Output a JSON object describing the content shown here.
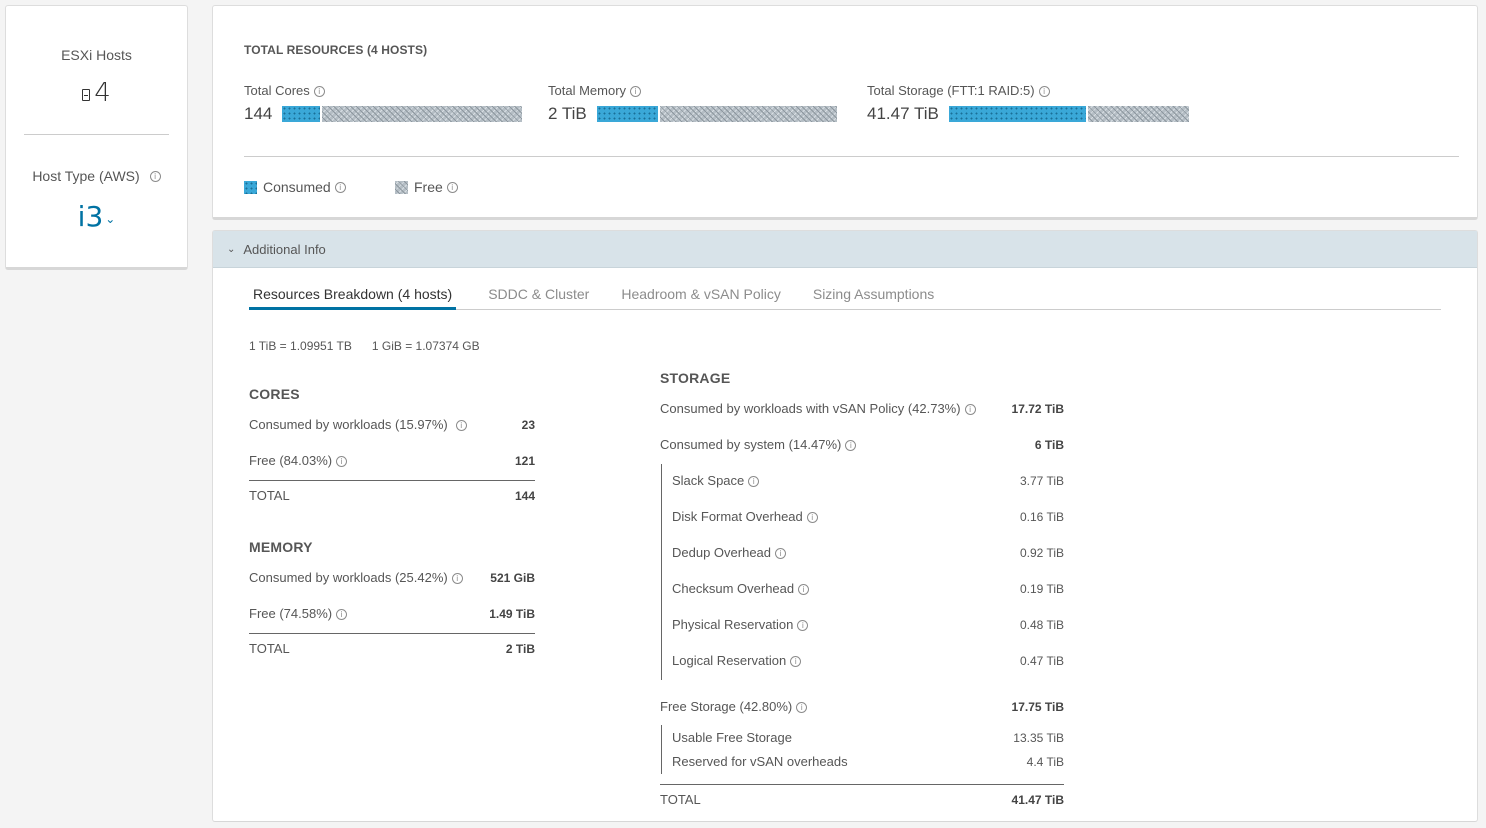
{
  "hosts": {
    "esxi_label": "ESXi Hosts",
    "esxi_count": "4",
    "host_type_label": "Host Type (AWS)",
    "host_type_value": "i3"
  },
  "resources": {
    "title": "TOTAL RESOURCES (4 HOSTS)",
    "metrics": [
      {
        "label": "Total Cores",
        "value": "144",
        "consumed_pct": 15.97
      },
      {
        "label": "Total Memory",
        "value": "2 TiB",
        "consumed_pct": 25.42
      },
      {
        "label": "Total Storage (FTT:1 RAID:5)",
        "value": "41.47 TiB",
        "consumed_pct": 57.2
      }
    ],
    "legend": {
      "consumed": "Consumed",
      "free": "Free"
    }
  },
  "colors": {
    "consumed": "#3aa8d8",
    "free": "#b5bec5",
    "accent": "#0072a3"
  },
  "info": {
    "header": "Additional Info",
    "tabs": [
      "Resources Breakdown (4 hosts)",
      "SDDC & Cluster",
      "Headroom & vSAN Policy",
      "Sizing Assumptions"
    ],
    "conversions": [
      "1 TiB = 1.09951 TB",
      "1 GiB = 1.07374 GB"
    ]
  },
  "cores": {
    "title": "CORES",
    "rows": [
      {
        "label": "Consumed by workloads (15.97%)",
        "value": "23"
      },
      {
        "label": "Free (84.03%)",
        "value": "121"
      }
    ],
    "total_label": "TOTAL",
    "total_value": "144"
  },
  "memory": {
    "title": "MEMORY",
    "rows": [
      {
        "label": "Consumed by workloads (25.42%)",
        "value": "521 GiB"
      },
      {
        "label": "Free (74.58%)",
        "value": "1.49 TiB"
      }
    ],
    "total_label": "TOTAL",
    "total_value": "2 TiB"
  },
  "storage": {
    "title": "STORAGE",
    "workloads": {
      "label": "Consumed by workloads with vSAN Policy (42.73%)",
      "value": "17.72 TiB"
    },
    "system": {
      "label": "Consumed by system (14.47%)",
      "value": "6 TiB"
    },
    "system_items": [
      {
        "label": "Slack Space",
        "value": "3.77 TiB"
      },
      {
        "label": "Disk Format Overhead",
        "value": "0.16 TiB"
      },
      {
        "label": "Dedup Overhead",
        "value": "0.92 TiB"
      },
      {
        "label": "Checksum Overhead",
        "value": "0.19 TiB"
      },
      {
        "label": "Physical Reservation",
        "value": "0.48 TiB"
      },
      {
        "label": "Logical Reservation",
        "value": "0.47 TiB"
      }
    ],
    "free": {
      "label": "Free Storage (42.80%)",
      "value": "17.75 TiB"
    },
    "free_items": [
      {
        "label": "Usable Free Storage",
        "value": "13.35 TiB"
      },
      {
        "label": "Reserved for vSAN overheads",
        "value": "4.4 TiB"
      }
    ],
    "total_label": "TOTAL",
    "total_value": "41.47 TiB"
  }
}
